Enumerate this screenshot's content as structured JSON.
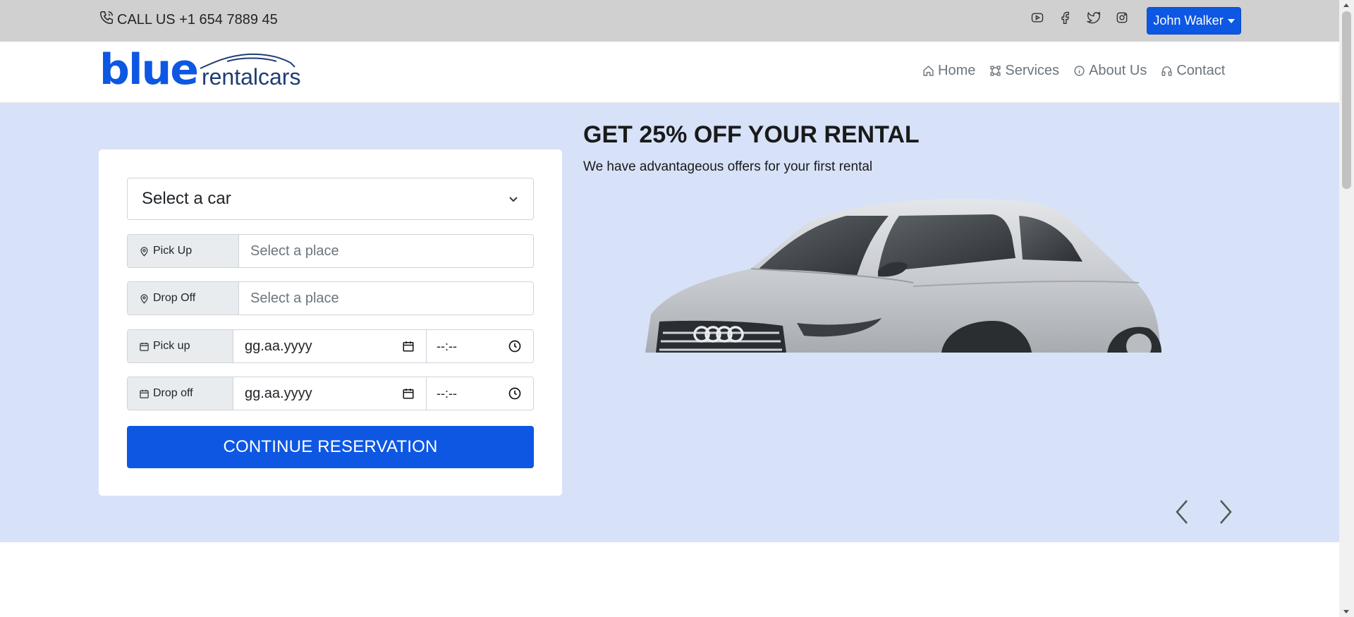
{
  "topbar": {
    "call_text": "CALL US +1 654 7889 45",
    "social_icons": [
      "youtube-icon",
      "facebook-icon",
      "twitter-icon",
      "instagram-icon"
    ],
    "user_name": "John Walker"
  },
  "logo": {
    "word1": "blue",
    "word2": "rentalcars"
  },
  "nav": {
    "items": [
      {
        "label": "Home",
        "icon": "home-icon"
      },
      {
        "label": "Services",
        "icon": "services-icon"
      },
      {
        "label": "About Us",
        "icon": "info-icon"
      },
      {
        "label": "Contact",
        "icon": "headphones-icon"
      }
    ]
  },
  "form": {
    "car_select": "Select a car",
    "pickup_label": "Pick Up",
    "pickup_placeholder": "Select a place",
    "dropoff_label": "Drop Off",
    "dropoff_placeholder": "Select a place",
    "pickup_date_label": "Pick up",
    "pickup_date": "gg.aa.yyyy",
    "pickup_time": "--:--",
    "dropoff_date_label": "Drop off",
    "dropoff_date": "gg.aa.yyyy",
    "dropoff_time": "--:--",
    "submit": "CONTINUE RESERVATION"
  },
  "promo": {
    "title": "GET 25% OFF YOUR RENTAL",
    "subtitle": "We have advantageous offers for your first rental"
  },
  "colors": {
    "brand": "#0d57e3",
    "hero_bg": "#d7e2f9",
    "topbar_bg": "#d0d0d0"
  }
}
